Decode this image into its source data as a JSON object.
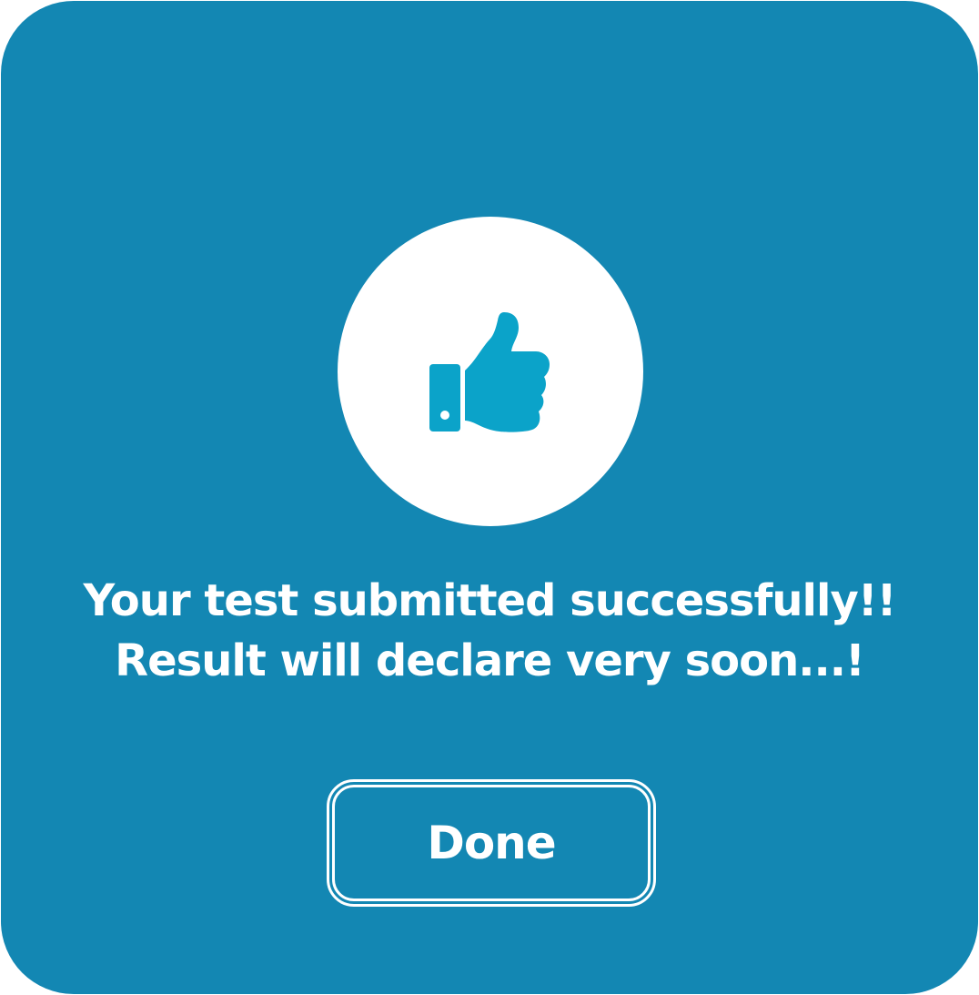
{
  "dialog": {
    "background_color": "#1387b3",
    "icon": {
      "name": "thumbs-up-icon",
      "circle_color": "#ffffff",
      "icon_color": "#0ba3c9"
    },
    "message": {
      "line1": "Your test submitted successfully!!",
      "line2": "Result will declare very soon...!"
    },
    "done_button": {
      "label": "Done"
    }
  }
}
